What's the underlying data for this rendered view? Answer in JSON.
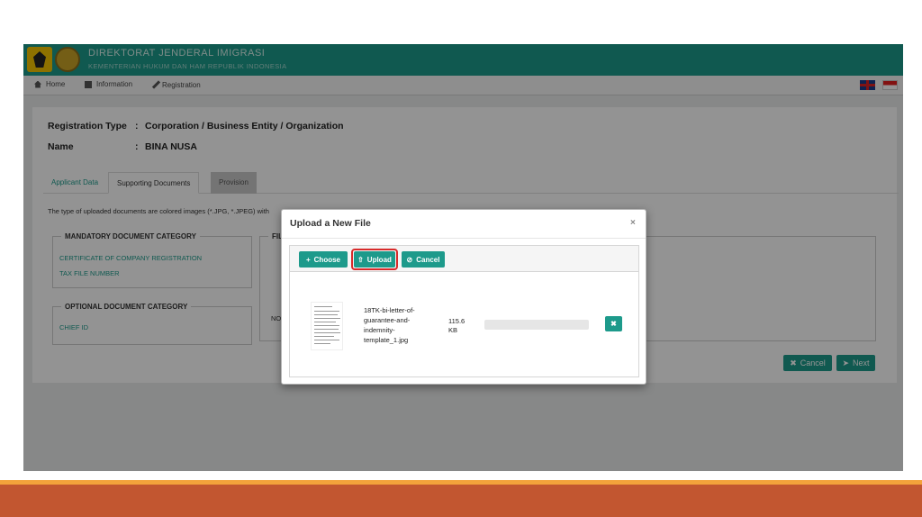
{
  "header": {
    "title": "DIREKTORAT JENDERAL IMIGRASI",
    "subtitle": "KEMENTERIAN HUKUM DAN HAM REPUBLIK INDONESIA"
  },
  "nav": {
    "items": [
      {
        "label": "Home",
        "icon": "home-icon"
      },
      {
        "label": "Information",
        "icon": "book-icon"
      },
      {
        "label": "Registration",
        "icon": "pencil-icon"
      }
    ],
    "languages": [
      "English",
      "Indonesia"
    ]
  },
  "registration": {
    "type_label": "Registration Type",
    "type_sep": ":",
    "type_value": "Corporation / Business Entity / Organization",
    "name_label": "Name",
    "name_sep": ":",
    "name_value": "BINA NUSA"
  },
  "tabs": [
    "Applicant Data",
    "Supporting Documents",
    "Provision"
  ],
  "note": "The type of uploaded documents are colored images (*.JPG, *.JPEG) with",
  "mandatory": {
    "title": "MANDATORY DOCUMENT CATEGORY",
    "items": [
      "CERTIFICATE OF COMPANY REGISTRATION",
      "TAX FILE NUMBER"
    ]
  },
  "optional": {
    "title": "OPTIONAL DOCUMENT CATEGORY",
    "items": [
      "CHIEF ID"
    ]
  },
  "file_panel": {
    "legend": "FIL",
    "no_text": "NO"
  },
  "footer_buttons": {
    "cancel": "Cancel",
    "next": "Next"
  },
  "modal": {
    "title": "Upload a New File",
    "close": "×",
    "buttons": {
      "choose": "Choose",
      "upload": "Upload",
      "cancel": "Cancel"
    },
    "file": {
      "name": "18TK-bi-letter-of-guarantee-and-indemnity-template_1.jpg",
      "size": "115.6 KB",
      "progress_percent": 0
    }
  },
  "colors": {
    "brand": "#1d9a8b",
    "highlight": "#d82b2b",
    "slide_accent": "#c25630"
  }
}
